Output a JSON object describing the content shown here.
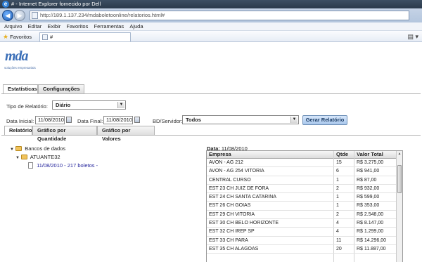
{
  "browser": {
    "title": "# - Internet Explorer fornecido por Dell",
    "address": "http://189.1.137.234/mdaboletoonline/relatorios.html#",
    "address_host": "189.1.137.234",
    "menu": [
      "Arquivo",
      "Editar",
      "Exibir",
      "Favoritos",
      "Ferramentas",
      "Ajuda"
    ],
    "favorites_label": "Favoritos",
    "tab_title": "#"
  },
  "logo": {
    "name": "mda",
    "tagline": "soluções empresariais"
  },
  "top_tabs": [
    "Estatísticas",
    "Configurações"
  ],
  "form": {
    "tipo_label": "Tipo de Relatório:",
    "tipo_value": "Diário",
    "data_inicial_label": "Data Inicial:",
    "data_inicial_value": "11/08/2010",
    "data_final_label": "Data Final:",
    "data_final_value": "11/08/2010",
    "servidor_label": "BD/Servidor:",
    "servidor_value": "Todos",
    "gerar_label": "Gerar Relatório"
  },
  "report_tabs": [
    "Relatório",
    "Gráfico por Quantidade",
    "Gráfico por Valores"
  ],
  "tree": {
    "root": "Bancos de dados",
    "child": "ATUANTE32",
    "leaf": "11/08/2010 - 217 boletos -"
  },
  "data": {
    "label": "Data:",
    "value": "11/08/2010",
    "columns": [
      "Empresa",
      "Qtde",
      "Valor Total"
    ],
    "rows": [
      [
        "AVON - AG 212",
        "15",
        "R$ 3.275,00"
      ],
      [
        "AVON - AG 254 VITORIA",
        "6",
        "R$ 941,00"
      ],
      [
        "CENTRAL  CURSO",
        "1",
        "R$ 87,00"
      ],
      [
        "EST 23 CH JUIZ DE FORA",
        "2",
        "R$ 932,00"
      ],
      [
        "EST 24 CH SANTA CATARINA",
        "1",
        "R$ 599,00"
      ],
      [
        "EST 26 CH GOIAS",
        "1",
        "R$ 353,00"
      ],
      [
        "EST 29 CH VITORIA",
        "2",
        "R$ 2.548,00"
      ],
      [
        "EST 30 CH BELO HORIZONTE",
        "4",
        "R$ 8.147,00"
      ],
      [
        "EST 32 CH IREP SP",
        "4",
        "R$ 1.299,00"
      ],
      [
        "EST 33 CH PARA",
        "11",
        "R$ 14.296,00"
      ],
      [
        "EST 35 CH ALAGOAS",
        "20",
        "R$ 11.887,00"
      ]
    ]
  }
}
